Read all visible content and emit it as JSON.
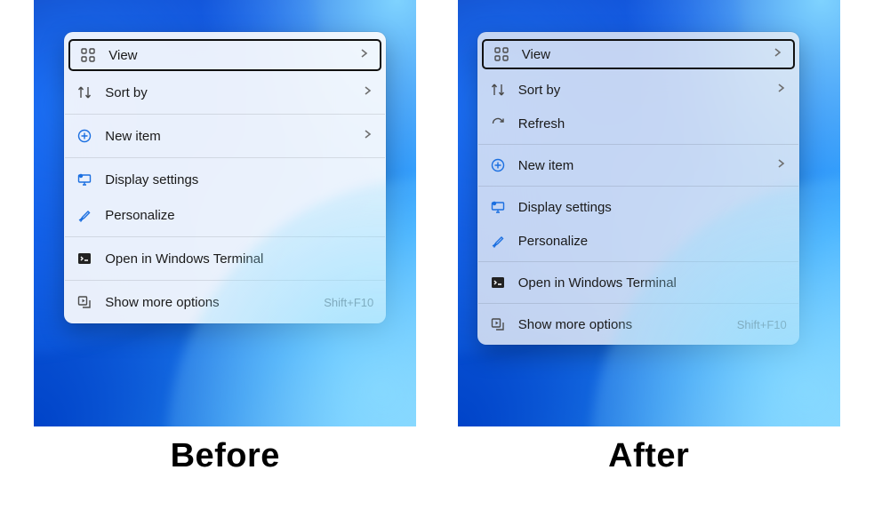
{
  "before": {
    "caption": "Before",
    "items": [
      {
        "icon": "grid-icon",
        "label": "View",
        "submenu": true,
        "focused": true
      },
      {
        "icon": "sort-icon",
        "label": "Sort by",
        "submenu": true
      },
      "---",
      {
        "icon": "plus-circle-icon",
        "label": "New item",
        "submenu": true
      },
      "---",
      {
        "icon": "display-gear-icon",
        "label": "Display settings"
      },
      {
        "icon": "brush-icon",
        "label": "Personalize"
      },
      "---",
      {
        "icon": "terminal-icon",
        "label": "Open in Windows Terminal"
      },
      "---",
      {
        "icon": "more-icon",
        "label": "Show more options",
        "accelerator": "Shift+F10"
      }
    ]
  },
  "after": {
    "caption": "After",
    "items": [
      {
        "icon": "grid-icon",
        "label": "View",
        "submenu": true,
        "focused": true
      },
      {
        "icon": "sort-icon",
        "label": "Sort by",
        "submenu": true
      },
      {
        "icon": "refresh-icon",
        "label": "Refresh"
      },
      "---",
      {
        "icon": "plus-circle-icon",
        "label": "New item",
        "submenu": true
      },
      "---",
      {
        "icon": "display-gear-icon",
        "label": "Display settings"
      },
      {
        "icon": "brush-icon",
        "label": "Personalize"
      },
      "---",
      {
        "icon": "terminal-icon",
        "label": "Open in Windows Terminal"
      },
      "---",
      {
        "icon": "more-icon",
        "label": "Show more options",
        "accelerator": "Shift+F10"
      }
    ]
  }
}
